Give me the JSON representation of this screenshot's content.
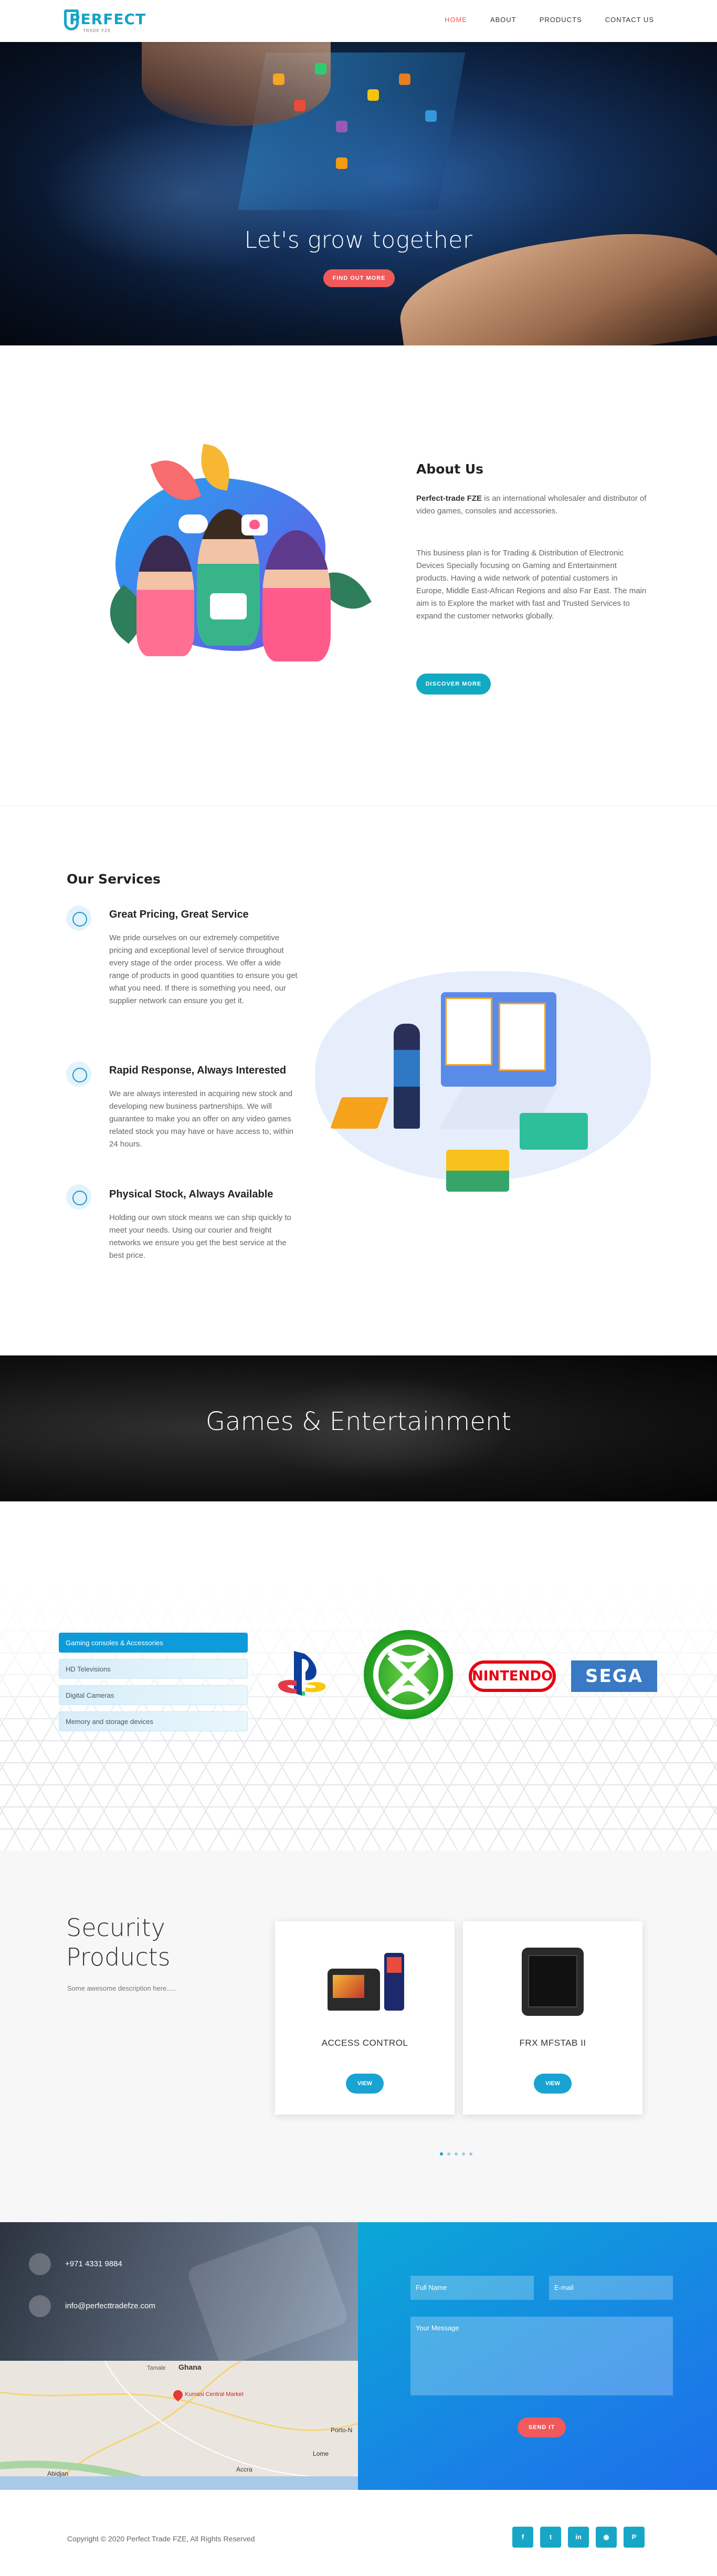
{
  "header": {
    "logo_text": "PERFECT",
    "logo_sub": "TRADE FZE",
    "nav": [
      "HOME",
      "ABOUT",
      "PRODUCTS",
      "CONTACT US"
    ],
    "active_nav": "HOME",
    "colors": {
      "brand": "#16a1c6",
      "active": "#f05a5a"
    }
  },
  "hero": {
    "title": "Let's grow together",
    "button": "FIND OUT MORE"
  },
  "about": {
    "title": "About Us",
    "company": "Perfect-trade FZE",
    "intro_rest": " is an international wholesaler and distributor of video games, consoles and accessories.",
    "paragraph": "This business plan is for Trading & Distribution of Electronic Devices Specially focusing on Gaming and Entertainment products. Having a wide network of potential customers in Europe, Middle East-African Regions and also Far East. The main aim is to Explore the market with fast and Trusted Services to expand the customer networks globally.",
    "button": "DISCOVER MORE"
  },
  "services": {
    "title": "Our Services",
    "items": [
      {
        "title": "Great Pricing, Great Service",
        "icon": "price-tag-icon",
        "text": "We pride ourselves on our extremely competitive pricing and exceptional level of service throughout every stage of the order process. We offer a wide range of products in good quantities to ensure you get what you need. If there is something you need, our supplier network can ensure you get it."
      },
      {
        "title": "Rapid Response, Always Interested",
        "icon": "response-icon",
        "text": "We are always interested in acquiring new stock and developing new business partnerships. We will guarantee to make you an offer on any video games related stock you may have or have access to, within 24 hours."
      },
      {
        "title": "Physical Stock, Always Available",
        "icon": "stock-icon",
        "text": "Holding our own stock means we can ship quickly to meet your needs. Using our courier and freight networks we ensure you get the best service at the best price."
      }
    ]
  },
  "games": {
    "title": "Games & Entertainment",
    "categories": [
      "Gaming consoles & Accessories",
      "HD Televisions",
      "Digital Cameras",
      "Memory and storage devices"
    ],
    "active_category": 0,
    "brands": [
      "PlayStation",
      "Xbox",
      "NINTENDO",
      "SEGA"
    ]
  },
  "security": {
    "title": "Security Products",
    "description": "Some awesome description here.....",
    "cards": [
      {
        "title": "ACCESS CONTROL",
        "button": "VIEW"
      },
      {
        "title": "FRX MFSTAB II",
        "button": "VIEW"
      }
    ],
    "pager_count": 5,
    "pager_active": 0
  },
  "contact": {
    "phone": "+971 4331 9884",
    "email": "info@perfecttradefze.com",
    "map_labels": [
      "Ghana",
      "Kumasi Central Market",
      "Accra",
      "Lome",
      "Abidjan",
      "Tamale",
      "Porto-N"
    ],
    "form": {
      "full_name": "Full Name",
      "email": "E-mail",
      "message": "Your Message",
      "send": "SEND IT"
    }
  },
  "footer": {
    "copyright": "Copyright © 2020 Perfect Trade FZE, All Rights Reserved",
    "social": [
      "facebook-icon",
      "twitter-icon",
      "linkedin-icon",
      "rss-icon",
      "pinterest-icon"
    ]
  }
}
